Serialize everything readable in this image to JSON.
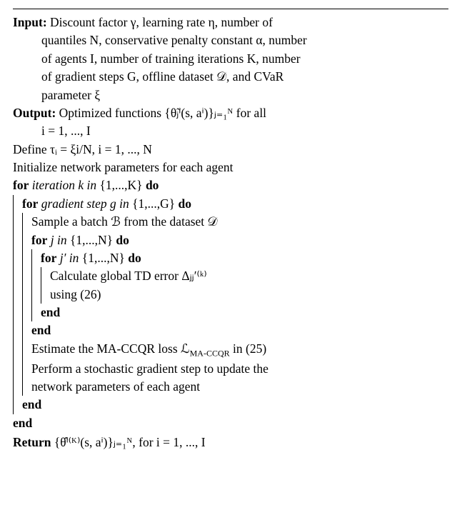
{
  "input": {
    "label": "Input:",
    "text1": " Discount factor γ, learning rate η, number of",
    "text2": "quantiles N, conservative penalty constant α, number",
    "text3": "of agents I, number of training iterations K, number",
    "text4": "of gradient steps G, offline dataset 𝒟, and CVaR",
    "text5": "parameter ξ"
  },
  "output": {
    "label": "Output:",
    "text1": " Optimized functions {θ̃ⱼⁱ(s, aⁱ)}ⱼ₌₁ᴺ for all",
    "text2": "i = 1, ..., I"
  },
  "define": "Define τᵢ = ξi/N,  i = 1, ..., N",
  "init": "Initialize network parameters for each agent",
  "for_k": {
    "head": "for",
    "cond_i": " iteration k in ",
    "set": "{1,...,K}",
    "do": " do"
  },
  "for_g": {
    "head": "for",
    "cond_i": " gradient step g in ",
    "set": "{1,...,G}",
    "do": " do"
  },
  "sample": "Sample a batch ℬ from the dataset 𝒟",
  "for_j": {
    "head": "for",
    "cond_i": " j in ",
    "set": "{1,...,N}",
    "do": " do"
  },
  "for_jp": {
    "head": "for",
    "cond_i": " j′ in ",
    "set": "{1,...,N}",
    "do": " do"
  },
  "calc1": "Calculate global TD error Δⱼⱼ′⁽ᵏ⁾",
  "calc2": " using (26)",
  "end": "end",
  "estimate": "Estimate the MA-CCQR loss ℒ",
  "estimate_sub": "MA-CCQR",
  "estimate_tail": " in (25)",
  "perform1": "Perform a stochastic gradient step to update the",
  "perform2": "network parameters of each agent",
  "return": {
    "label": "Return",
    "text": " {θ̂ⁱ⁽ᴷ⁾(s, aⁱ)}ⱼ₌₁ᴺ,  for i = 1, ..., I"
  }
}
